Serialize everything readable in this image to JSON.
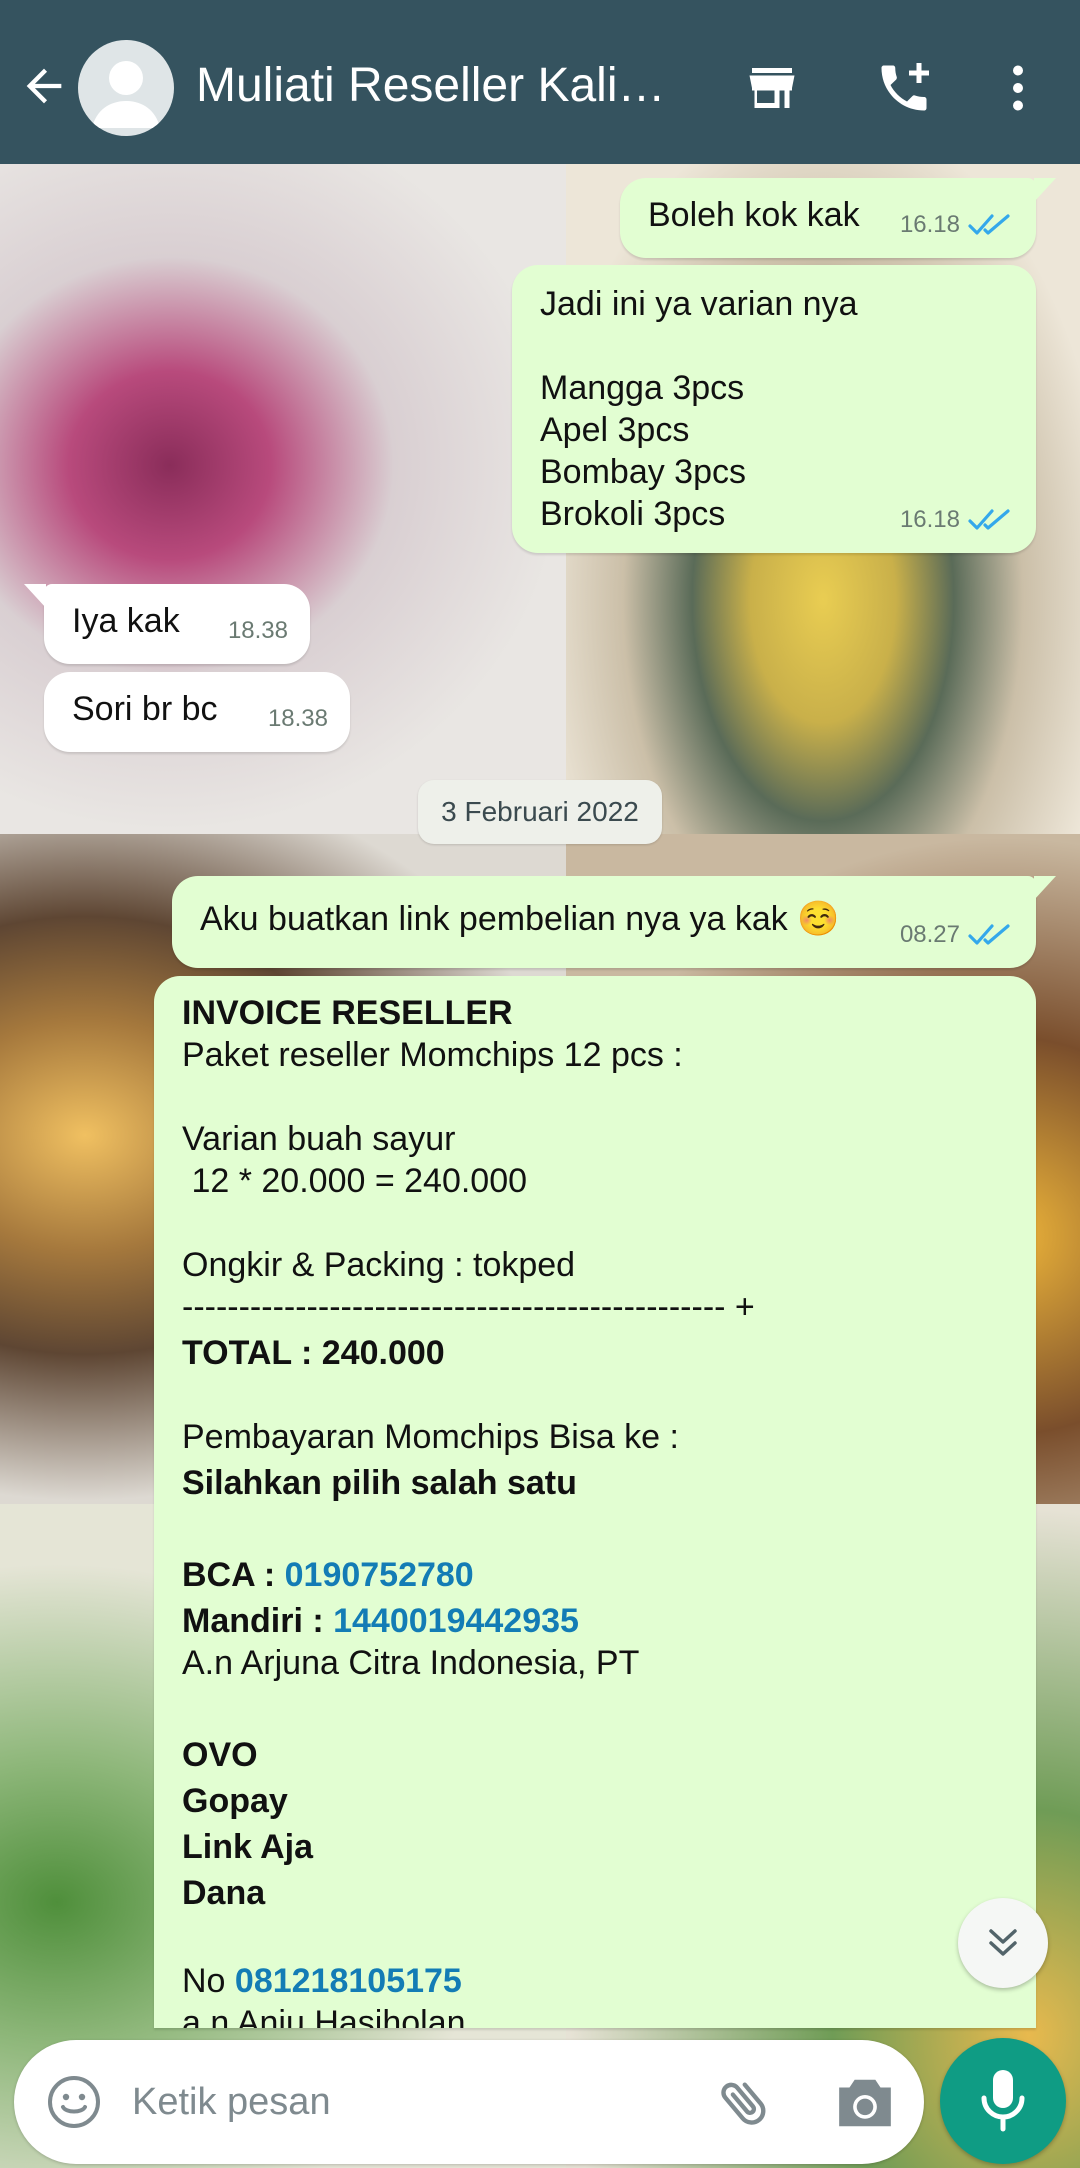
{
  "header": {
    "title": "Muliati Reseller Kali…",
    "icons": [
      "back-arrow-icon",
      "avatar-icon",
      "store-icon",
      "add-call-icon",
      "more-vert-icon"
    ],
    "color": "#35535f"
  },
  "messages": [
    {
      "dir": "out",
      "text": "Boleh kok kak",
      "time": "16.18",
      "status": "read"
    },
    {
      "dir": "out",
      "text": "Jadi ini ya varian nya\n\nMangga 3pcs\nApel 3pcs\nBombay 3pcs\nBrokoli 3pcs",
      "time": "16.18",
      "status": "read"
    },
    {
      "dir": "in",
      "text": "Iya kak",
      "time": "18.38"
    },
    {
      "dir": "in",
      "text": "Sori br bc",
      "time": "18.38"
    },
    {
      "dir": "out",
      "text": "Aku buatkan link pembelian nya ya kak ☺️",
      "time": "08.27",
      "status": "read"
    }
  ],
  "date_chip": "3 Februari 2022",
  "invoice": {
    "title": "INVOICE RESELLER",
    "line1": "Paket reseller Momchips 12 pcs :",
    "line2": "Varian buah sayur",
    "line3": " 12 * 20.000 = 240.000",
    "line4": "Ongkir & Packing : tokped",
    "separator": "------------------------------------------------ +",
    "total": "TOTAL : 240.000",
    "pay_line": "Pembayaran Momchips Bisa ke :",
    "pay_choose": "Silahkan pilih salah satu",
    "bca_label": "BCA : ",
    "bca_number": "0190752780",
    "mandiri_label": "Mandiri : ",
    "mandiri_number": "1440019442935",
    "account_name": "A.n Arjuna Citra Indonesia, PT",
    "wallet1": "OVO",
    "wallet2": "Gopay",
    "wallet3": "Link Aja",
    "wallet4": "Dana",
    "no_label": "No ",
    "phone": "081218105175",
    "an_line": "a.n Anju Hasiholan"
  },
  "composer": {
    "placeholder": "Ketik pesan",
    "accent": "#0f9c84"
  },
  "colors": {
    "outgoing_bubble": "#e2fed2",
    "incoming_bubble": "#ffffff",
    "link": "#137cb5",
    "read_tick": "#34a8eb"
  }
}
